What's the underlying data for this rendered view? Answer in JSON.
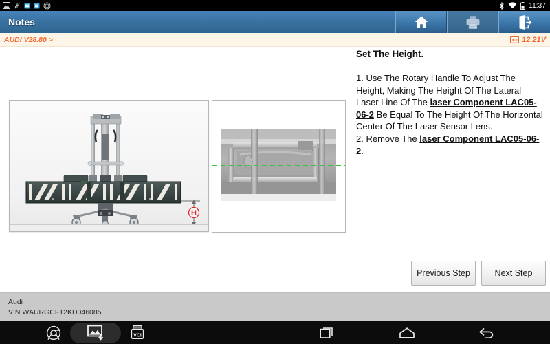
{
  "status_bar": {
    "icons": [
      "screenshot-icon",
      "usb-icon",
      "app-icon-1",
      "app-icon-2",
      "bluetooth-settings-icon"
    ],
    "right_icons": [
      "bluetooth-icon",
      "wifi-icon",
      "battery-icon"
    ],
    "clock": "11:37"
  },
  "title_bar": {
    "title": "Notes",
    "buttons": [
      {
        "name": "home-button",
        "icon": "home-icon"
      },
      {
        "name": "print-button",
        "icon": "printer-icon"
      },
      {
        "name": "exit-button",
        "icon": "exit-icon"
      }
    ]
  },
  "sub_bar": {
    "version": "AUDI V28.80 >",
    "voltage": "12.21V",
    "battery_icon": "battery-icon",
    "accent_color": "#f06a33",
    "background": "#fdf6e8"
  },
  "main": {
    "heading": "Set The Height.",
    "paragraph_plain": "1. Use The Rotary Handle To Adjust The Height, Making The Height Of The Lateral Laser Line Of The laser Component LAC05-06-2 Be Equal To The Height Of The Horizontal Center Of The Laser Sensor Lens.\n2. Remove The laser Component LAC05-06-2.",
    "text_segments": [
      {
        "text": "1. Use The Rotary Handle To Adjust The Height, Making The Height Of The Lateral Laser Line Of The ",
        "link": false
      },
      {
        "text": "laser Component LAC05-06-2",
        "link": true
      },
      {
        "text": " Be Equal To The Height Of The Horizontal Center Of The Laser Sensor Lens.\n2. Remove The ",
        "link": false
      },
      {
        "text": "laser Component LAC05-06-2",
        "link": true
      },
      {
        "text": ".",
        "link": false
      }
    ],
    "illustration": {
      "name": "calibration-target-diagram",
      "dimension_label": "H",
      "dimension_label_color": "#e02020"
    },
    "photo": {
      "name": "laser-line-closeup-photo",
      "laser_line_color": "#3cc23c"
    },
    "buttons": {
      "previous": "Previous Step",
      "next": "Next Step"
    }
  },
  "footer": {
    "make": "Audi",
    "vin": "VIN WAURGCF12KD046085"
  },
  "nav_bar": {
    "left_items": [
      {
        "name": "chrome-icon"
      },
      {
        "name": "screenshot-icon"
      },
      {
        "name": "vci-icon",
        "label": "VCI"
      }
    ],
    "right_items": [
      {
        "name": "recents-icon"
      },
      {
        "name": "home-icon"
      },
      {
        "name": "back-icon"
      }
    ]
  }
}
